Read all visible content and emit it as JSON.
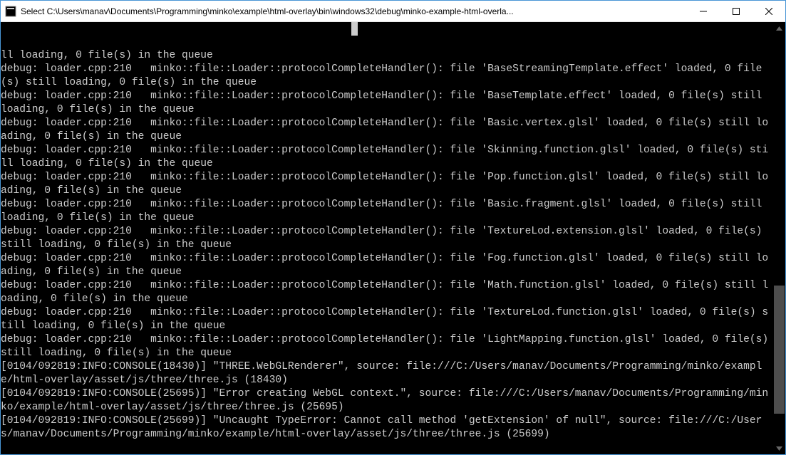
{
  "window": {
    "title": "Select C:\\Users\\manav\\Documents\\Programming\\minko\\example\\html-overlay\\bin\\windows32\\debug\\minko-example-html-overla..."
  },
  "console": {
    "lines": [
      "ll loading, 0 file(s) in the queue",
      "debug: loader.cpp:210   minko::file::Loader::protocolCompleteHandler(): file 'BaseStreamingTemplate.effect' loaded, 0 file(s) still loading, 0 file(s) in the queue",
      "debug: loader.cpp:210   minko::file::Loader::protocolCompleteHandler(): file 'BaseTemplate.effect' loaded, 0 file(s) still loading, 0 file(s) in the queue",
      "debug: loader.cpp:210   minko::file::Loader::protocolCompleteHandler(): file 'Basic.vertex.glsl' loaded, 0 file(s) still loading, 0 file(s) in the queue",
      "debug: loader.cpp:210   minko::file::Loader::protocolCompleteHandler(): file 'Skinning.function.glsl' loaded, 0 file(s) still loading, 0 file(s) in the queue",
      "debug: loader.cpp:210   minko::file::Loader::protocolCompleteHandler(): file 'Pop.function.glsl' loaded, 0 file(s) still loading, 0 file(s) in the queue",
      "debug: loader.cpp:210   minko::file::Loader::protocolCompleteHandler(): file 'Basic.fragment.glsl' loaded, 0 file(s) still loading, 0 file(s) in the queue",
      "debug: loader.cpp:210   minko::file::Loader::protocolCompleteHandler(): file 'TextureLod.extension.glsl' loaded, 0 file(s) still loading, 0 file(s) in the queue",
      "debug: loader.cpp:210   minko::file::Loader::protocolCompleteHandler(): file 'Fog.function.glsl' loaded, 0 file(s) still loading, 0 file(s) in the queue",
      "debug: loader.cpp:210   minko::file::Loader::protocolCompleteHandler(): file 'Math.function.glsl' loaded, 0 file(s) still loading, 0 file(s) in the queue",
      "debug: loader.cpp:210   minko::file::Loader::protocolCompleteHandler(): file 'TextureLod.function.glsl' loaded, 0 file(s) still loading, 0 file(s) in the queue",
      "debug: loader.cpp:210   minko::file::Loader::protocolCompleteHandler(): file 'LightMapping.function.glsl' loaded, 0 file(s) still loading, 0 file(s) in the queue",
      "[0104/092819:INFO:CONSOLE(18430)] \"THREE.WebGLRenderer\", source: file:///C:/Users/manav/Documents/Programming/minko/example/html-overlay/asset/js/three/three.js (18430)",
      "[0104/092819:INFO:CONSOLE(25695)] \"Error creating WebGL context.\", source: file:///C:/Users/manav/Documents/Programming/minko/example/html-overlay/asset/js/three/three.js (25695)",
      "[0104/092819:INFO:CONSOLE(25699)] \"Uncaught TypeError: Cannot call method 'getExtension' of null\", source: file:///C:/Users/manav/Documents/Programming/minko/example/html-overlay/asset/js/three/three.js (25699)"
    ]
  }
}
